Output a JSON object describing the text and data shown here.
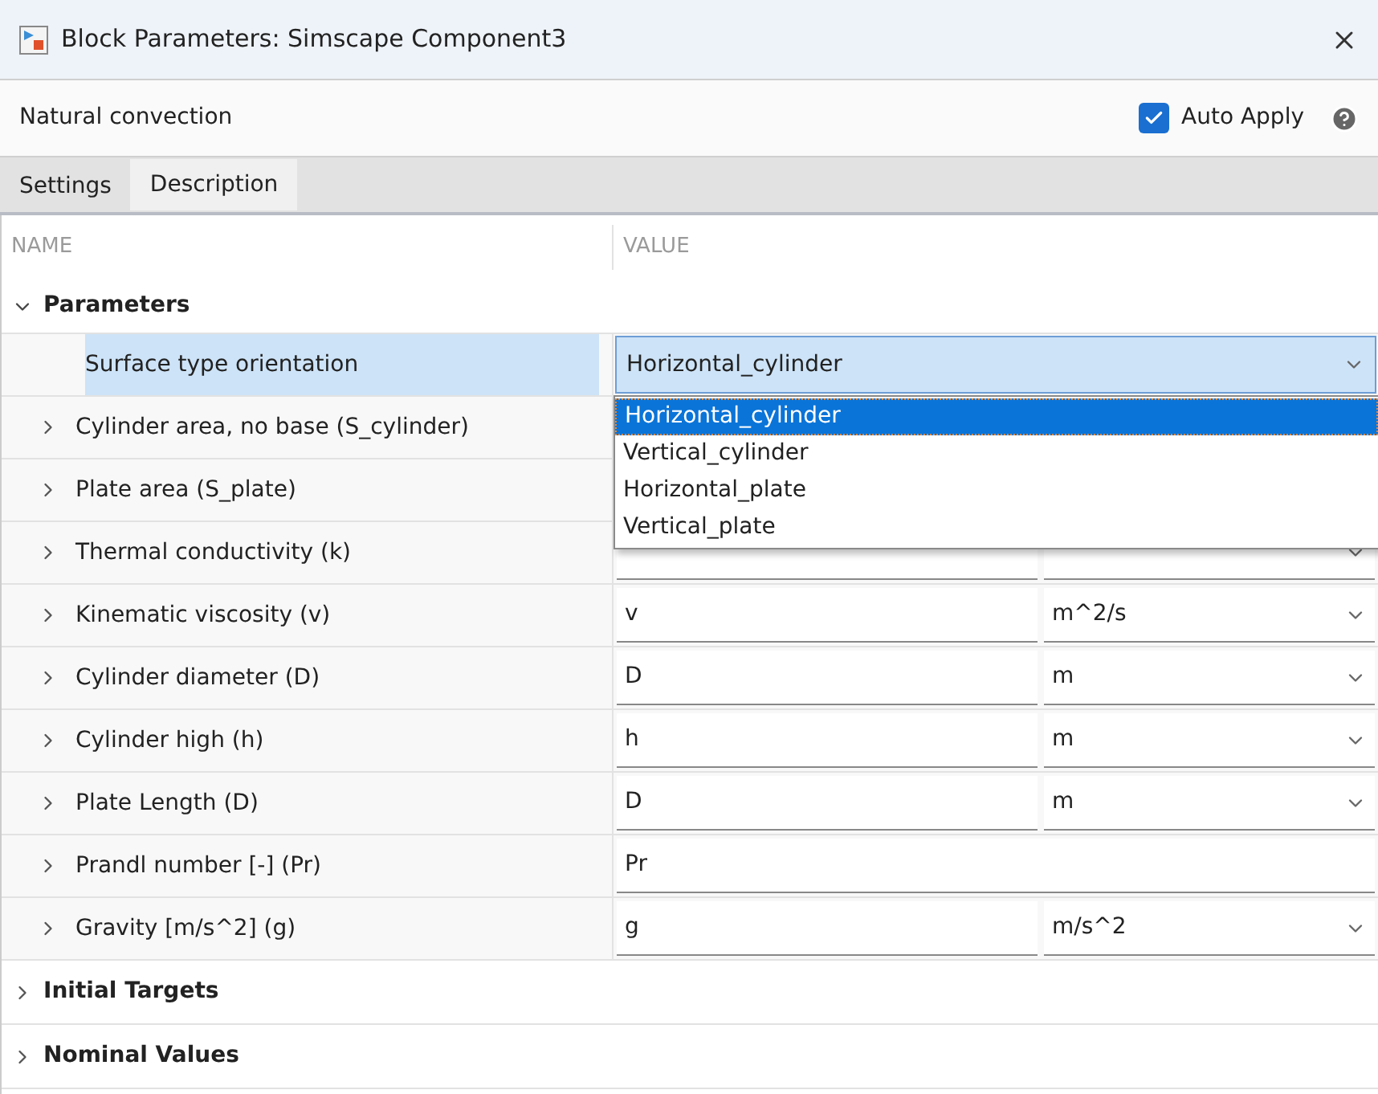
{
  "window": {
    "title": "Block Parameters: Simscape Component3"
  },
  "toolbar": {
    "block_name": "Natural convection",
    "auto_apply": {
      "label": "Auto Apply",
      "checked": true
    }
  },
  "tabs": [
    {
      "label": "Settings",
      "selected": true
    },
    {
      "label": "Description",
      "selected": false
    }
  ],
  "table": {
    "columns": [
      "NAME",
      "VALUE"
    ],
    "sections": [
      {
        "title": "Parameters",
        "expanded": true,
        "rows": [
          {
            "kind": "choice",
            "name": "Surface type orientation",
            "value": "Horizontal_cylinder",
            "selected": true,
            "options": [
              {
                "label": "Horizontal_cylinder",
                "selected": true
              },
              {
                "label": "Vertical_cylinder",
                "selected": false
              },
              {
                "label": "Horizontal_plate",
                "selected": false
              },
              {
                "label": "Vertical_plate",
                "selected": false
              }
            ]
          },
          {
            "kind": "parameter",
            "name": "Cylinder area, no base (S_cylinder)",
            "selected": false
          },
          {
            "kind": "parameter",
            "name": "Plate area (S_plate)",
            "selected": false
          },
          {
            "kind": "parameter",
            "name": "Thermal conductivity (k)",
            "has_unit": true,
            "selected": false
          },
          {
            "kind": "parameter",
            "name": "Kinematic viscosity (v)",
            "value": "v",
            "unit": "m^2/s",
            "selected": false
          },
          {
            "kind": "parameter",
            "name": "Cylinder diameter (D)",
            "value": "D",
            "unit": "m",
            "selected": false
          },
          {
            "kind": "parameter",
            "name": "Cylinder high (h)",
            "value": "h",
            "unit": "m",
            "selected": false
          },
          {
            "kind": "parameter",
            "name": "Plate Length (D)",
            "value": "D",
            "unit": "m",
            "selected": false
          },
          {
            "kind": "parameter",
            "name": "Prandl number [-] (Pr)",
            "value": "Pr",
            "selected": false
          },
          {
            "kind": "parameter",
            "name": "Gravity [m/s^2] (g)",
            "value": "g",
            "unit": "m/s^2",
            "selected": false
          }
        ]
      },
      {
        "title": "Initial Targets",
        "expanded": false
      },
      {
        "title": "Nominal Values",
        "expanded": false
      }
    ]
  }
}
